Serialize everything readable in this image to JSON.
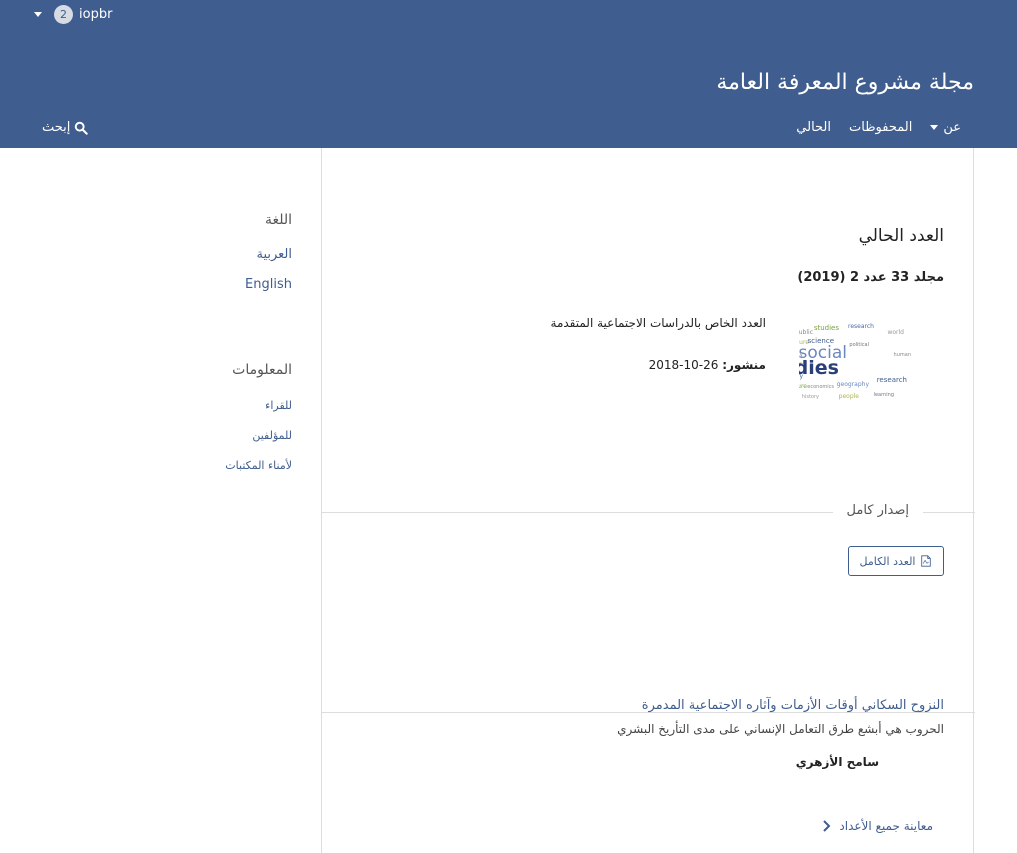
{
  "header": {
    "user": {
      "badge_count": "2",
      "username": "iopbr"
    },
    "site_title": "مجلة مشروع المعرفة العامة",
    "nav": [
      {
        "label": "الحالي"
      },
      {
        "label": "المحفوظات"
      },
      {
        "label": "عن",
        "has_dropdown": true
      }
    ],
    "search_label": "إبحث",
    "colors": {
      "header_bg": "#3f5d8e",
      "link": "#3f5d8e"
    }
  },
  "main": {
    "heading": "العدد الحالي",
    "issue_identification": "مجلد 33 عدد 2 (2019)",
    "cover_alt_words": [
      "social",
      "studies"
    ],
    "description": "العدد الخاص بالدراسات الاجتماعية المتقدمة",
    "published_label": "منشور:",
    "published_date": "26-10-2018",
    "full_issue_label": "إصدار كامل",
    "full_issue_button": "العدد الكامل",
    "article": {
      "title": "النزوح السكاني أوقات الأزمات وآثاره الاجتماعية المدمرة",
      "subtitle": "الحروب هي أبشع طرق التعامل الإنساني على مدى التأريخ البشري",
      "author": "سامح الأزهري"
    },
    "view_all": "معاينة جميع الأعداد"
  },
  "sidebar": {
    "language": {
      "title": "اللغة",
      "items": [
        "العربية",
        "English"
      ]
    },
    "information": {
      "title": "المعلومات",
      "items": [
        "للقراء",
        "للمؤلفين",
        "لأمناء المكتبات"
      ]
    }
  }
}
